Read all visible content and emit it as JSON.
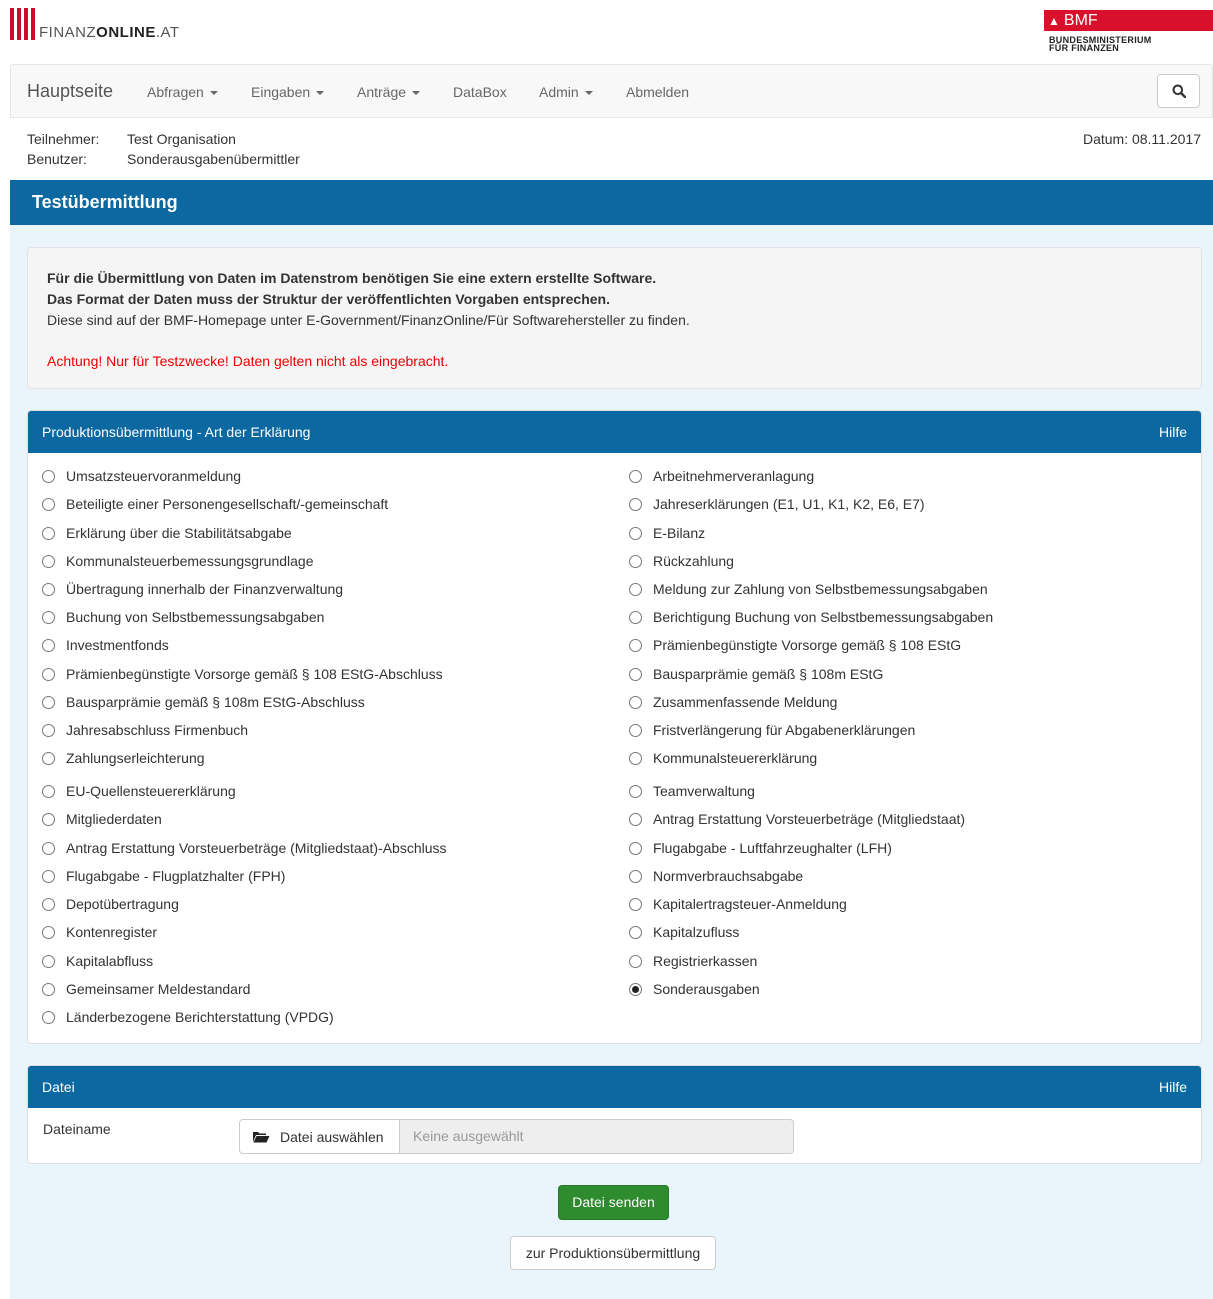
{
  "header": {
    "logo_left": {
      "prefix": "FINANZ",
      "strong": "ONLINE",
      "suffix": ".AT"
    },
    "logo_right": {
      "title": "BMF",
      "sub1": "BUNDESMINISTERIUM",
      "sub2": "FÜR FINANZEN"
    }
  },
  "nav": {
    "brand": "Hauptseite",
    "items": [
      {
        "label": "Abfragen",
        "dropdown": true
      },
      {
        "label": "Eingaben",
        "dropdown": true
      },
      {
        "label": "Anträge",
        "dropdown": true
      },
      {
        "label": "DataBox",
        "dropdown": false
      },
      {
        "label": "Admin",
        "dropdown": true
      },
      {
        "label": "Abmelden",
        "dropdown": false
      }
    ],
    "search_icon": "search-icon"
  },
  "userinfo": {
    "participant_label": "Teilnehmer:",
    "participant_value": "Test Organisation",
    "user_label": "Benutzer:",
    "user_value": "Sonderausgabenübermittler",
    "date": "Datum: 08.11.2017"
  },
  "banner": {
    "title": "Testübermittlung"
  },
  "info": {
    "line1": "Für die Übermittlung von Daten im Datenstrom benötigen Sie eine extern erstellte Software.",
    "line2": "Das Format der Daten muss der Struktur der veröffentlichten Vorgaben entsprechen.",
    "line3": "Diese sind auf der BMF-Homepage unter E-Government/FinanzOnline/Für Softwarehersteller zu finden.",
    "warning": "Achtung! Nur für Testzwecke! Daten gelten nicht als eingebracht."
  },
  "declaration_panel": {
    "title": "Produktionsübermittlung - Art der Erklärung",
    "help": "Hilfe",
    "left_options": [
      "Umsatzsteuervoranmeldung",
      "Beteiligte einer Personengesellschaft/-gemeinschaft",
      "Erklärung über die Stabilitätsabgabe",
      "Kommunalsteuerbemessungsgrundlage",
      "Übertragung innerhalb der Finanzverwaltung",
      "Buchung von Selbstbemessungsabgaben",
      "Investmentfonds",
      "Prämienbegünstigte Vorsorge gemäß § 108 EStG-Abschluss",
      "Bausparprämie gemäß § 108m EStG-Abschluss",
      "Jahresabschluss Firmenbuch",
      "Zahlungserleichterung",
      "EU-Quellensteuererklärung",
      "Mitgliederdaten",
      "Antrag Erstattung Vorsteuerbeträge (Mitgliedstaat)-Abschluss",
      "Flugabgabe - Flugplatzhalter (FPH)",
      "Depotübertragung",
      "Kontenregister",
      "Kapitalabfluss",
      "Gemeinsamer Meldestandard",
      "Länderbezogene Berichterstattung (VPDG)"
    ],
    "right_options": [
      "Arbeitnehmerveranlagung",
      "Jahreserklärungen (E1, U1, K1, K2, E6, E7)",
      "E-Bilanz",
      "Rückzahlung",
      "Meldung zur Zahlung von Selbstbemessungsabgaben",
      "Berichtigung Buchung von Selbstbemessungsabgaben",
      "Prämienbegünstigte Vorsorge gemäß § 108 EStG",
      "Bausparprämie gemäß § 108m EStG",
      "Zusammenfassende Meldung",
      "Fristverlängerung für Abgabenerklärungen",
      "Kommunalsteuererklärung",
      "Teamverwaltung",
      "Antrag Erstattung Vorsteuerbeträge (Mitgliedstaat)",
      "Flugabgabe - Luftfahrzeughalter (LFH)",
      "Normverbrauchsabgabe",
      "Kapitalertragsteuer-Anmeldung",
      "Kapitalzufluss",
      "Registrierkassen",
      "Sonderausgaben"
    ],
    "selected": "Sonderausgaben"
  },
  "file_panel": {
    "title": "Datei",
    "help": "Hilfe",
    "label": "Dateiname",
    "button": "Datei auswählen",
    "placeholder": "Keine ausgewählt",
    "folder_icon": "folder-open-icon"
  },
  "actions": {
    "send": "Datei senden",
    "back": "zur Produktionsübermittlung"
  }
}
